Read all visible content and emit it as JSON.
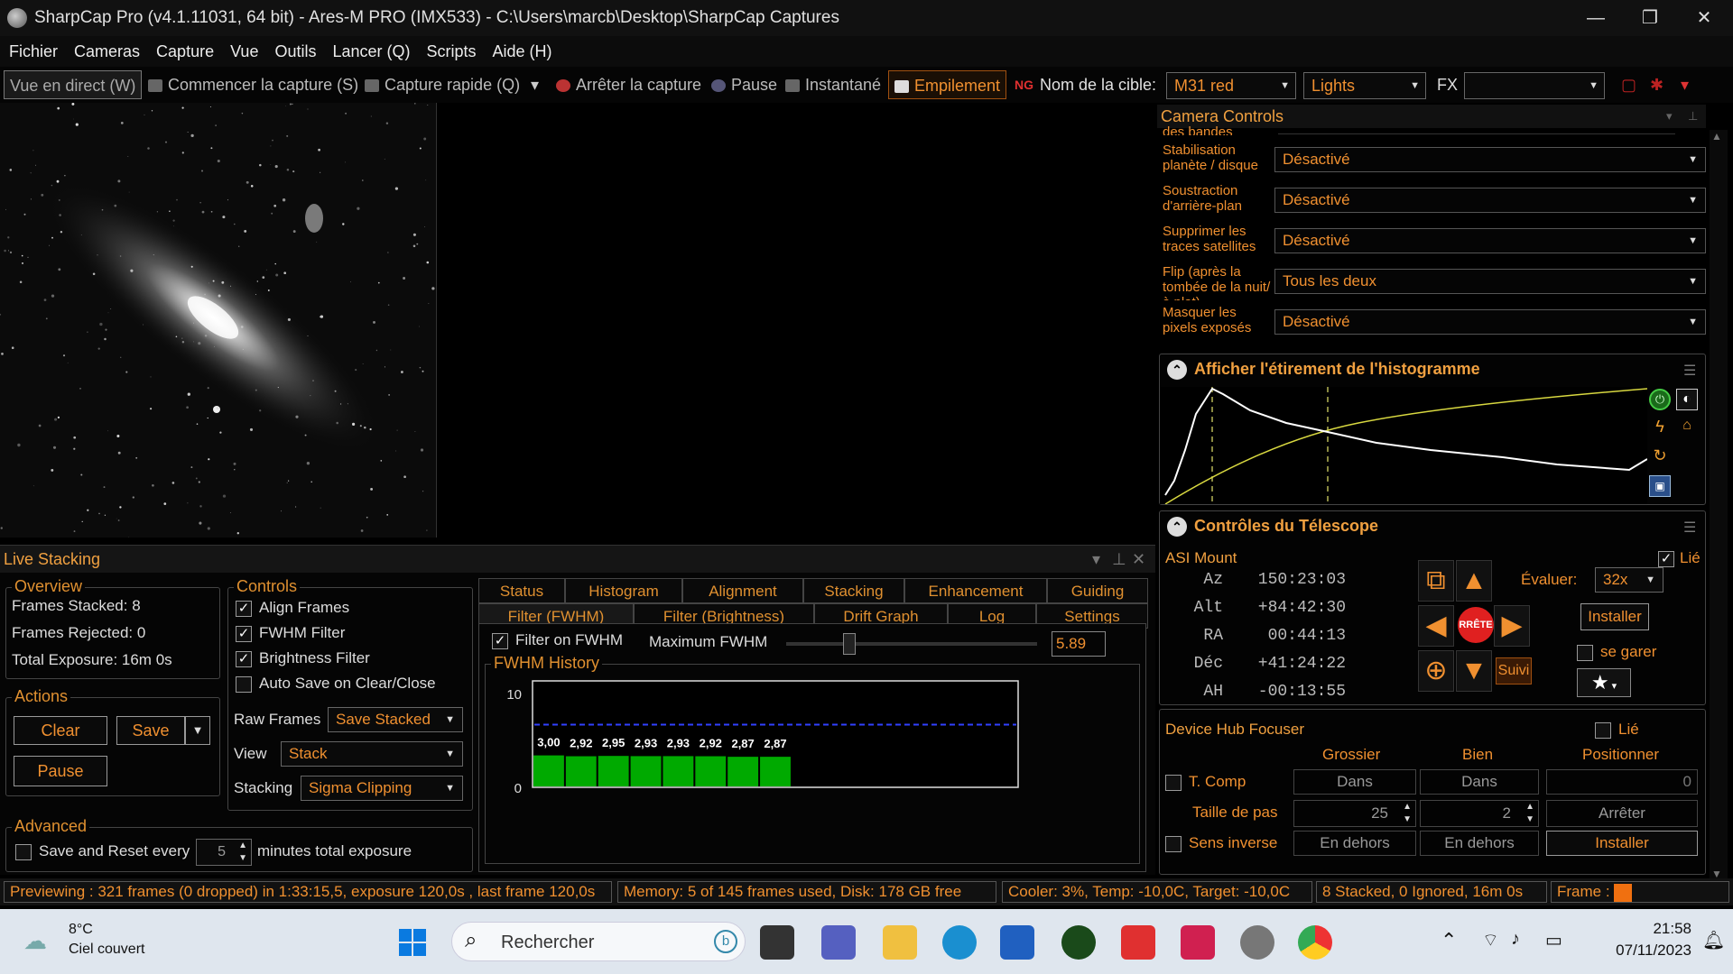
{
  "window": {
    "title": "SharpCap Pro (v4.1.11031, 64 bit) - Ares-M PRO (IMX533) - C:\\Users\\marcb\\Desktop\\SharpCap Captures",
    "minimize": "—",
    "restore": "❐",
    "close": "✕"
  },
  "menu": [
    "Fichier",
    "Cameras",
    "Capture",
    "Vue",
    "Outils",
    "Lancer (Q)",
    "Scripts",
    "Aide (H)"
  ],
  "toolbar": {
    "live_view": "Vue en direct (W)",
    "start_capture": "Commencer la capture (S)",
    "quick_capture": "Capture rapide (Q)",
    "stop_capture": "Arrêter la capture",
    "pause": "Pause",
    "snapshot": "Instantané",
    "stacking": "Empilement",
    "target_label": "Nom de la cible:",
    "target_value": "M31 red",
    "frame_type": "Lights",
    "fx_label": "FX",
    "fx_value": ""
  },
  "live_stacking": {
    "title": "Live Stacking",
    "overview": {
      "label": "Overview",
      "frames_stacked": "Frames Stacked:  8",
      "frames_rejected": "Frames Rejected: 0",
      "total_exposure": "Total Exposure:    16m 0s"
    },
    "actions": {
      "label": "Actions",
      "clear": "Clear",
      "save": "Save",
      "pause": "Pause"
    },
    "controls": {
      "label": "Controls",
      "align_frames": "Align Frames",
      "fwhm_filter": "FWHM Filter",
      "brightness_filter": "Brightness Filter",
      "auto_save": "Auto Save on Clear/Close",
      "raw_frames_label": "Raw Frames",
      "raw_frames_value": "Save Stacked",
      "view_label": "View",
      "view_value": "Stack",
      "stacking_label": "Stacking",
      "stacking_value": "Sigma Clipping"
    },
    "advanced": {
      "label": "Advanced",
      "save_reset": "Save and Reset every",
      "minutes_value": "5",
      "minutes_label": "minutes total exposure"
    },
    "tabs_row1": [
      "Status",
      "Histogram",
      "Alignment",
      "Stacking",
      "Enhancement",
      "Guiding"
    ],
    "tabs_row2": [
      "Filter (FWHM)",
      "Filter (Brightness)",
      "Drift Graph",
      "Log",
      "Settings"
    ],
    "filter": {
      "filter_on_fwhm": "Filter on FWHM",
      "max_fwhm_label": "Maximum FWHM",
      "max_fwhm_value": "5.89",
      "slider_position": 0.25
    }
  },
  "chart_data": {
    "type": "bar",
    "title": "FWHM History",
    "ylim": [
      0,
      10
    ],
    "y_ticks": [
      "10",
      "0"
    ],
    "values": [
      3.0,
      2.92,
      2.95,
      2.93,
      2.93,
      2.92,
      2.87,
      2.87
    ],
    "labels": [
      "3,00",
      "2,92",
      "2,95",
      "2,93",
      "2,93",
      "2,92",
      "2,87",
      "2,87"
    ],
    "max_slots": 15,
    "threshold": 5.89,
    "bar_color": "#00aa00",
    "threshold_color": "#3040ff"
  },
  "camera_controls": {
    "title": "Camera Controls",
    "cut_label": "des bandes",
    "rows": [
      {
        "label": "Stabilisation planète / disque",
        "value": "Désactivé"
      },
      {
        "label": "Soustraction d'arrière-plan",
        "value": "Désactivé"
      },
      {
        "label": "Supprimer les traces satellites",
        "value": "Désactivé"
      },
      {
        "label": "Flip (après la tombée de la nuit/à plat)",
        "value": "Tous les deux"
      },
      {
        "label": "Masquer les pixels exposés",
        "value": "Désactivé"
      }
    ]
  },
  "histogram": {
    "title": "Afficher l'étirement de l'histogramme"
  },
  "telescope": {
    "title": "Contrôles du Télescope",
    "mount": "ASI Mount",
    "linked": "Lié",
    "coords": [
      {
        "k": "Az",
        "v": "150:23:03"
      },
      {
        "k": "Alt",
        "v": "+84:42:30"
      },
      {
        "k": "RA",
        "v": "00:44:13"
      },
      {
        "k": "Déc",
        "v": "+41:24:22"
      },
      {
        "k": "AH",
        "v": "-00:13:55"
      }
    ],
    "rate_label": "Évaluer:",
    "rate_value": "32x",
    "stop": "RRÊTE",
    "install": "Installer",
    "park": "se garer",
    "track": "Suivi"
  },
  "focuser": {
    "title": "Device Hub Focuser",
    "linked": "Lié",
    "col_coarse": "Grossier",
    "col_fine": "Bien",
    "col_position": "Positionner",
    "tcomp": "T. Comp",
    "in_coarse": "Dans",
    "in_fine": "Dans",
    "position": "0",
    "step_label": "Taille de pas",
    "step_coarse": "25",
    "step_fine": "2",
    "stop": "Arrêter",
    "reverse": "Sens inverse",
    "out_coarse": "En dehors",
    "out_fine": "En dehors",
    "install": "Installer"
  },
  "status": {
    "preview": "Previewing : 321 frames (0 dropped) in 1:33:15,5, exposure 120,0s , last frame 120,0s",
    "memory": "Memory: 5 of 145 frames used, Disk: 178 GB free",
    "cooler": "Cooler: 3%, Temp: -10,0C, Target: -10,0C",
    "stacked": "8 Stacked, 0 Ignored, 16m 0s",
    "frame": "Frame :"
  },
  "taskbar": {
    "temp": "8°C",
    "weather": "Ciel couvert",
    "search": "Rechercher",
    "time": "21:58",
    "date": "07/11/2023"
  }
}
